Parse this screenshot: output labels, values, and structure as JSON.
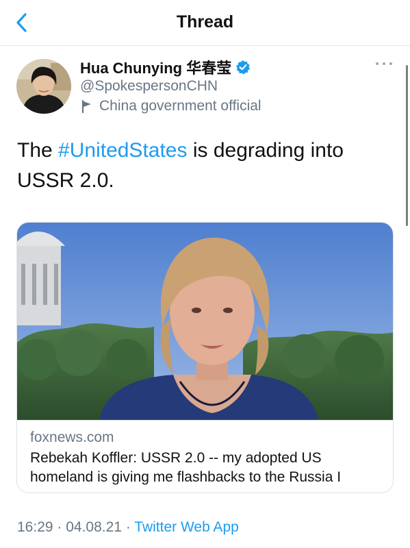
{
  "header": {
    "title": "Thread"
  },
  "user": {
    "name": "Hua Chunying 华春莹",
    "handle": "@SpokespersonCHN",
    "label": "China government official"
  },
  "tweet": {
    "text_before": "The ",
    "hashtag": "#UnitedStates",
    "text_after": " is degrading into USSR 2.0."
  },
  "card": {
    "domain": "foxnews.com",
    "title": "Rebekah Koffler: USSR 2.0 -- my adopted US homeland is giving me flashbacks to the Russia I"
  },
  "meta": {
    "time": "16:29",
    "separator": " · ",
    "date": "04.08.21",
    "source": "Twitter Web App"
  },
  "colors": {
    "accent": "#1d9bf0",
    "secondary_text": "#687684",
    "border": "#dfe3e6"
  },
  "icons": {
    "back": "chevron-left-icon",
    "verified": "verified-badge-icon",
    "label": "flag-icon",
    "more": "more-dots-icon"
  }
}
